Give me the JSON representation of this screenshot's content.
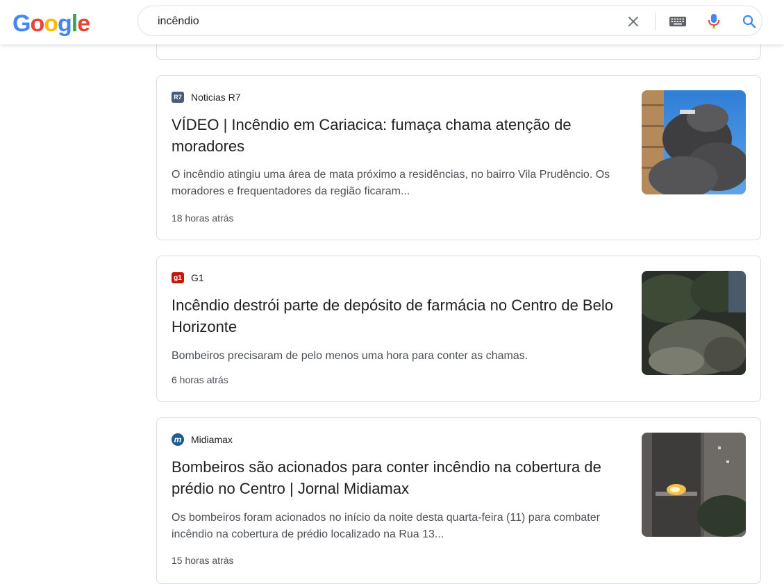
{
  "header": {
    "logo_letters": [
      {
        "char": "G",
        "color": "#4285F4"
      },
      {
        "char": "o",
        "color": "#EA4335"
      },
      {
        "char": "o",
        "color": "#FBBC05"
      },
      {
        "char": "g",
        "color": "#4285F4"
      },
      {
        "char": "l",
        "color": "#34A853"
      },
      {
        "char": "e",
        "color": "#EA4335"
      }
    ],
    "search_query": "incêndio",
    "icons": [
      "close-icon",
      "keyboard-icon",
      "microphone-icon",
      "search-icon"
    ]
  },
  "results": [
    {
      "source": "Noticias R7",
      "favicon_text": "R7",
      "title": "VÍDEO | Incêndio em Cariacica: fumaça chama atenção de moradores",
      "snippet": "O incêndio atingiu uma área de mata próximo a residências, no bairro Vila Prudêncio. Os moradores e frequentadores da região ficaram...",
      "time": "18 horas atrás"
    },
    {
      "source": "G1",
      "favicon_text": "g1",
      "title": "Incêndio destrói parte de depósito de farmácia no Centro de Belo Horizonte",
      "snippet": "Bombeiros precisaram de pelo menos uma hora para conter as chamas.",
      "time": "6 horas atrás"
    },
    {
      "source": "Midiamax",
      "favicon_text": "m",
      "title": "Bombeiros são acionados para conter incêndio na cobertura de prédio no Centro | Jornal Midiamax",
      "snippet": "Os bombeiros foram acionados no início da noite desta quarta-feira (11) para combater incêndio na cobertura de prédio localizado na Rua 13...",
      "time": "15 horas atrás"
    }
  ],
  "colors": {
    "mic_blue": "#4285F4",
    "mic_red": "#EA4335",
    "search_blue": "#4285F4"
  }
}
